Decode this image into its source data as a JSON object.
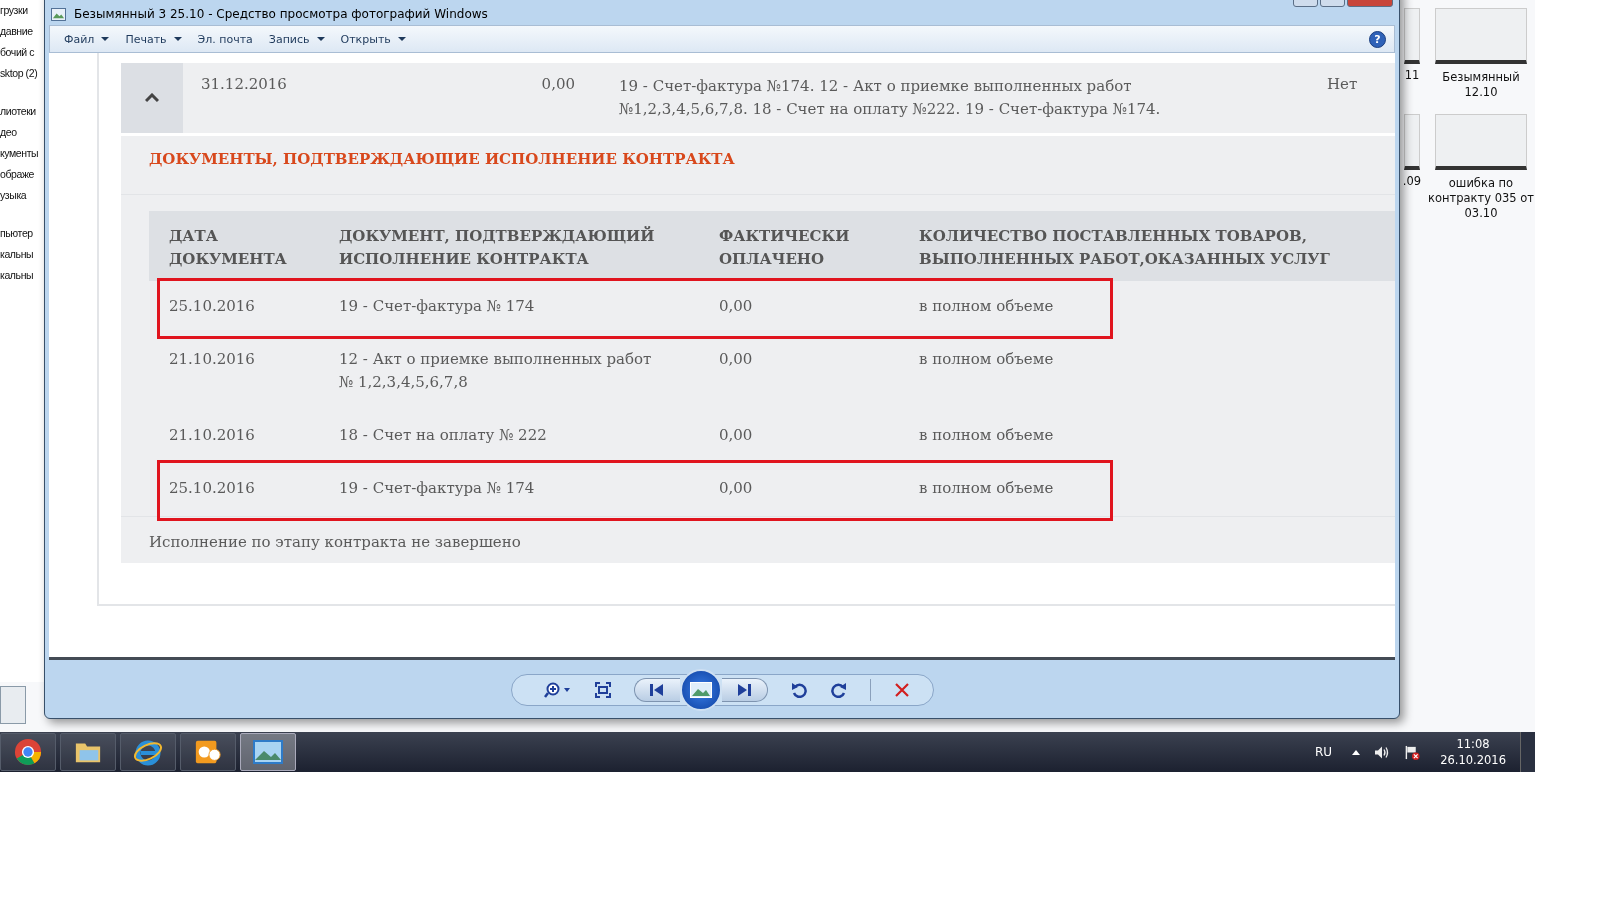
{
  "window": {
    "title": "Безымянный 3 25.10 - Средство просмотра фотографий Windows",
    "help": "?",
    "menu": [
      {
        "label": "Файл",
        "dropdown": true
      },
      {
        "label": "Печать",
        "dropdown": true
      },
      {
        "label": "Эл. почта",
        "dropdown": false
      },
      {
        "label": "Запись",
        "dropdown": true
      },
      {
        "label": "Открыть",
        "dropdown": true
      }
    ]
  },
  "explorer_sidebar": {
    "items": [
      "грузки",
      "давние",
      "бочий с",
      "sktop (2)",
      "лиотеки",
      "део",
      "кументы",
      "ображе",
      "узыка",
      "пьютер",
      "кальны",
      "кальны"
    ]
  },
  "desktop_icons": [
    {
      "label": "11"
    },
    {
      "label": "Безымянный 12.10"
    },
    {
      "label": ".09"
    },
    {
      "label": "ошибка по контракту 035 от 03.10"
    }
  ],
  "stage": {
    "expanded": true,
    "date": "31.12.2016",
    "amount": "0,00",
    "documents": "19 - Счет-фактура №174. 12 - Акт о приемке выполненных работ №1,2,3,4,5,6,7,8. 18 - Счет на оплату №222. 19 - Счет-фактура №174.",
    "status": "Нет"
  },
  "section": {
    "title": "ДОКУМЕНТЫ, ПОДТВЕРЖДАЮЩИЕ ИСПОЛНЕНИЕ КОНТРАКТА",
    "columns": [
      "ДАТА ДОКУМЕНТА",
      "ДОКУМЕНТ, ПОДТВЕРЖДАЮЩИЙ ИСПОЛНЕНИЕ КОНТРАКТА",
      "ФАКТИЧЕСКИ ОПЛАЧЕНО",
      "КОЛИЧЕСТВО ПОСТАВЛЕННЫХ ТОВАРОВ, ВЫПОЛНЕННЫХ РАБОТ,ОКАЗАННЫХ УСЛУГ"
    ],
    "rows": [
      {
        "date": "25.10.2016",
        "document": "19 - Счет-фактура № 174",
        "paid": "0,00",
        "quantity": "в полном объеме",
        "highlighted": true
      },
      {
        "date": "21.10.2016",
        "document": "12 - Акт о приемке выполненных работ № 1,2,3,4,5,6,7,8",
        "paid": "0,00",
        "quantity": "в полном объеме",
        "highlighted": false
      },
      {
        "date": "21.10.2016",
        "document": "18 - Счет на оплату № 222",
        "paid": "0,00",
        "quantity": "в полном объеме",
        "highlighted": false
      },
      {
        "date": "25.10.2016",
        "document": "19 - Счет-фактура № 174",
        "paid": "0,00",
        "quantity": "в полном объеме",
        "highlighted": true
      }
    ],
    "footer": "Исполнение по этапу контракта не завершено"
  },
  "taskbar": {
    "apps": [
      {
        "kind": "browser",
        "selected": false
      },
      {
        "kind": "folder",
        "selected": false
      },
      {
        "kind": "web",
        "selected": false
      },
      {
        "kind": "mail",
        "selected": false
      },
      {
        "kind": "photos",
        "selected": true
      }
    ]
  },
  "tray": {
    "language": "RU",
    "time": "11:08",
    "date": "26.10.2016"
  }
}
